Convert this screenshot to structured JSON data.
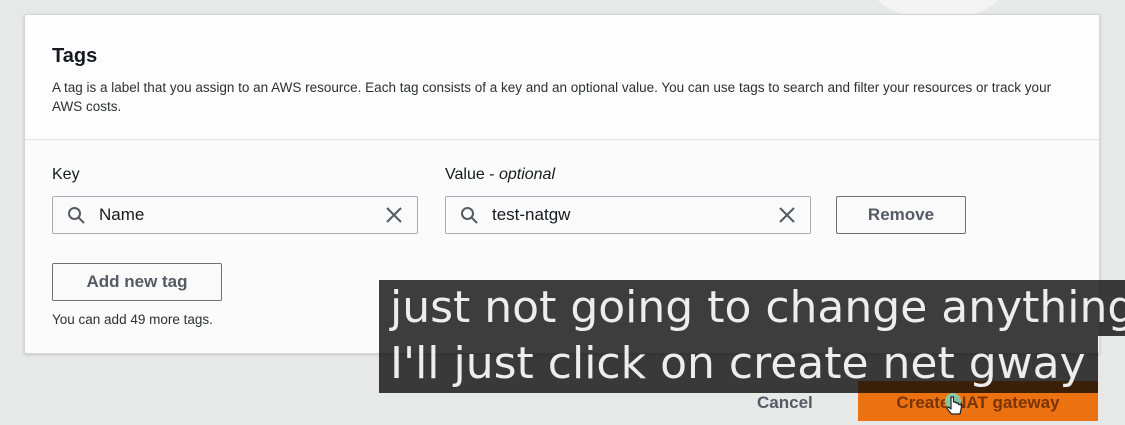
{
  "tags_section": {
    "title": "Tags",
    "description": "A tag is a label that you assign to an AWS resource. Each tag consists of a key and an optional value. You can use tags to search and filter your resources or track your AWS costs.",
    "key_label": "Key",
    "value_label_prefix": "Value - ",
    "value_label_suffix": "optional",
    "tag": {
      "key": "Name",
      "value": "test-natgw"
    },
    "remove_label": "Remove",
    "add_tag_label": "Add new tag",
    "remaining_hint": "You can add 49 more tags."
  },
  "footer": {
    "cancel_label": "Cancel",
    "create_label": "Create NAT gateway"
  },
  "captions": {
    "line1": "just not going to change anything a",
    "line2": "I'll just click on create net gway"
  },
  "icons": {
    "search": "search-icon",
    "clear": "close-icon",
    "cursor": "hand-pointer-icon"
  },
  "colors": {
    "primary_button": "#ec7211",
    "caption_background": "#080808"
  }
}
